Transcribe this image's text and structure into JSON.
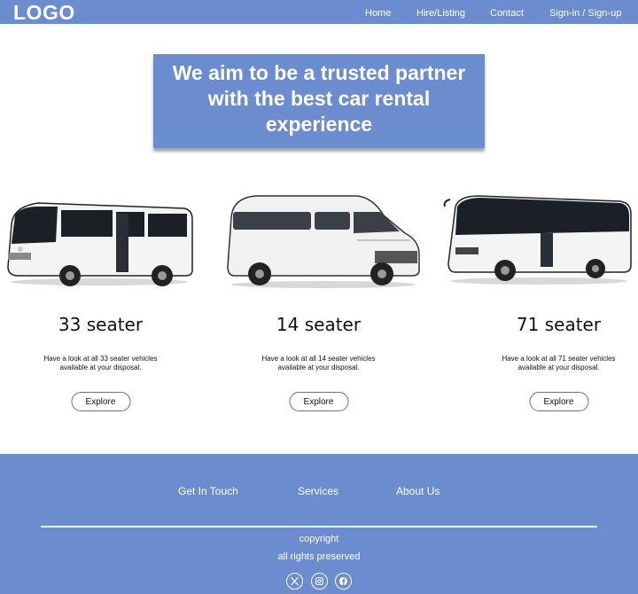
{
  "header": {
    "logo": "LOGO",
    "nav": [
      "Home",
      "Hire/Listing",
      "Contact",
      "Sign-in / Sign-up"
    ]
  },
  "hero": {
    "title": "We aim to be a trusted partner with the best car rental experience"
  },
  "vehicles": [
    {
      "title": "33 seater",
      "description": "Have a look at all 33 seater vehicles available at your disposal.",
      "button": "Explore",
      "icon": "minibus-icon"
    },
    {
      "title": "14 seater",
      "description": "Have a look at all 14 seater vehicles available at your disposal.",
      "button": "Explore",
      "icon": "van-icon"
    },
    {
      "title": "71 seater",
      "description": "Have a look at all 71 seater vehicles available at your disposal.",
      "button": "Explore",
      "icon": "coach-bus-icon"
    }
  ],
  "footer": {
    "links": [
      "Get In Touch",
      "Services",
      "About Us"
    ],
    "copyright": "copyright",
    "rights": "all rights preserved",
    "social": [
      "x-icon",
      "instagram-icon",
      "facebook-icon"
    ]
  },
  "colors": {
    "brand": "#6b8ccf",
    "text": "#111111",
    "button_border": "#6b6f80"
  }
}
